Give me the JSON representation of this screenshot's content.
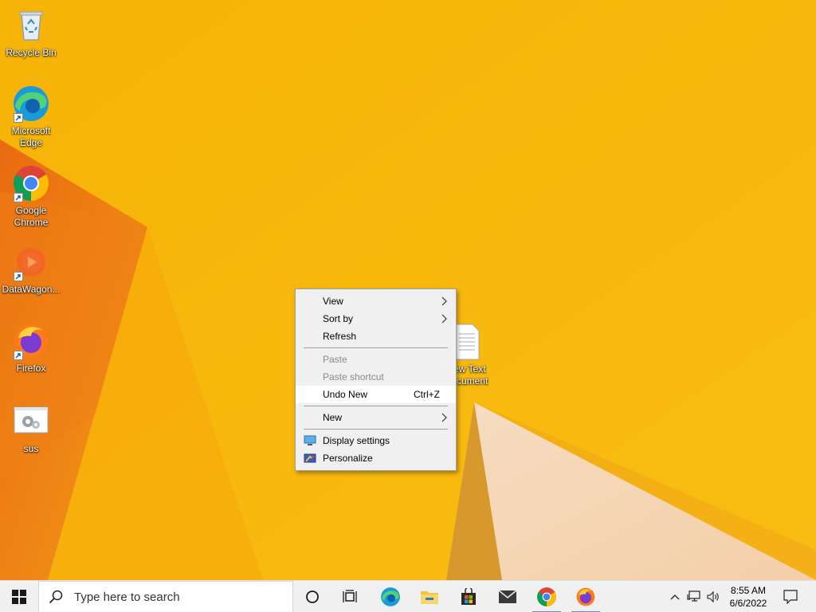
{
  "desktop": {
    "icons": [
      {
        "label": "Recycle Bin",
        "icon": "recycle-bin-icon"
      },
      {
        "label": "Microsoft Edge",
        "icon": "edge-icon"
      },
      {
        "label": "Google Chrome",
        "icon": "chrome-icon"
      },
      {
        "label": "DataWagon...",
        "icon": "datawagon-icon"
      },
      {
        "label": "Firefox",
        "icon": "firefox-icon"
      },
      {
        "label": "sus",
        "icon": "settings-file-icon"
      },
      {
        "label": "New Text Document",
        "icon": "text-document-icon"
      }
    ]
  },
  "context_menu": {
    "items": [
      {
        "label": "View",
        "submenu": true
      },
      {
        "label": "Sort by",
        "submenu": true
      },
      {
        "label": "Refresh"
      },
      {
        "label": "Paste",
        "disabled": true
      },
      {
        "label": "Paste shortcut",
        "disabled": true
      },
      {
        "label": "Undo New",
        "shortcut": "Ctrl+Z"
      },
      {
        "label": "New",
        "submenu": true
      },
      {
        "label": "Display settings",
        "icon": "display-icon"
      },
      {
        "label": "Personalize",
        "icon": "personalize-icon"
      }
    ]
  },
  "taskbar": {
    "search_placeholder": "Type here to search",
    "apps": [
      "cortana-icon",
      "task-view-icon",
      "edge-icon",
      "file-explorer-icon",
      "store-icon",
      "mail-icon",
      "chrome-icon",
      "firefox-icon"
    ],
    "time": "8:55 AM",
    "date": "6/6/2022"
  },
  "colors": {
    "wallpaper": "#f6b40a",
    "wallpaper_dark": "#ee7a12",
    "menu_bg": "#f0f0f0",
    "taskbar_bg": "#f0f0f0"
  }
}
